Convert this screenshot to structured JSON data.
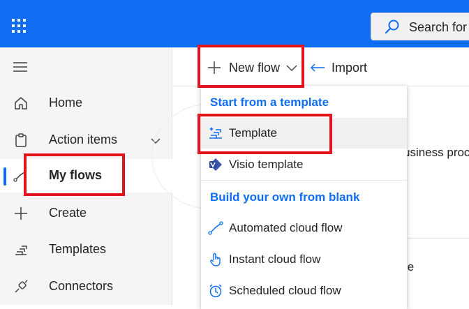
{
  "header": {
    "search_placeholder": "Search for l",
    "accent": "#0f6cf3"
  },
  "sidebar": {
    "items": [
      {
        "label": "Home",
        "icon": "home-icon"
      },
      {
        "label": "Action items",
        "icon": "clipboard-icon",
        "expandable": true
      },
      {
        "label": "My flows",
        "icon": "flow-icon",
        "selected": true
      },
      {
        "label": "Create",
        "icon": "plus-icon"
      },
      {
        "label": "Templates",
        "icon": "templates-icon"
      },
      {
        "label": "Connectors",
        "icon": "connector-icon"
      }
    ]
  },
  "commandbar": {
    "new_flow": "New flow",
    "import": "Import"
  },
  "background": {
    "text1": "usiness proc",
    "text2": "le"
  },
  "dropdown": {
    "section1": "Start from a template",
    "section2": "Build your own from blank",
    "items": [
      {
        "label": "Template",
        "icon": "template-icon"
      },
      {
        "label": "Visio template",
        "icon": "visio-icon"
      },
      {
        "label": "Automated cloud flow",
        "icon": "automated-flow-icon"
      },
      {
        "label": "Instant cloud flow",
        "icon": "touch-icon"
      },
      {
        "label": "Scheduled cloud flow",
        "icon": "alarm-clock-icon"
      }
    ]
  },
  "highlight_color": "#e3141e"
}
